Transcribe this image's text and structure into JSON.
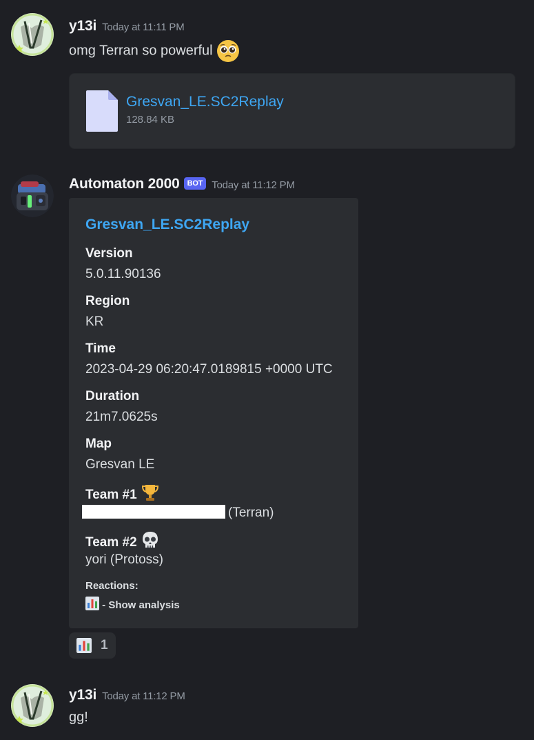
{
  "messages": [
    {
      "author": "y13i",
      "timestamp": "Today at 11:11 PM",
      "text": "omg Terran so powerful",
      "emoji": "pleading-face",
      "attachment": {
        "filename": "Gresvan_LE.SC2Replay",
        "size": "128.84 KB"
      }
    },
    {
      "author": "Automaton 2000",
      "bot_tag": "BOT",
      "timestamp": "Today at 11:12 PM",
      "embed": {
        "title": "Gresvan_LE.SC2Replay",
        "fields": [
          {
            "name": "Version",
            "value": "5.0.11.90136"
          },
          {
            "name": "Region",
            "value": "KR"
          },
          {
            "name": "Time",
            "value": "2023-04-29 06:20:47.0189815 +0000 UTC"
          },
          {
            "name": "Duration",
            "value": "21m7.0625s"
          },
          {
            "name": "Map",
            "value": "Gresvan LE"
          },
          {
            "name": "Team #1",
            "name_emoji": "trophy",
            "value": "(Terran)"
          },
          {
            "name": "Team #2",
            "name_emoji": "skull",
            "value": "yori (Protoss)"
          }
        ],
        "footer_label": "Reactions:",
        "footer_line": " - Show analysis"
      },
      "reaction": {
        "emoji": "bar-chart",
        "count": "1"
      }
    },
    {
      "author": "y13i",
      "timestamp": "Today at 11:12 PM",
      "text": "gg!"
    }
  ],
  "colors": {
    "background": "#1e1f24",
    "link": "#3ea6f2",
    "card": "#2b2d31",
    "bot_tag": "#5865f2"
  }
}
